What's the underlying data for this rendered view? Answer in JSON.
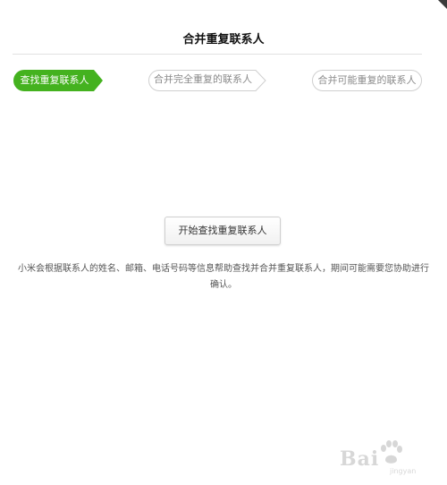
{
  "dialog": {
    "title": "合并重复联系人"
  },
  "steps": [
    {
      "label": "查找重复联系人",
      "state": "active"
    },
    {
      "label": "合并完全重复的联系人",
      "state": "inactive"
    },
    {
      "label": "合并可能重复的联系人",
      "state": "inactive"
    }
  ],
  "main": {
    "start_button_label": "开始查找重复联系人",
    "description": "小米会根据联系人的姓名、邮箱、电话号码等信息帮助查找并合并重复联系人，期间可能需要您协助进行确认。"
  },
  "watermark": {
    "logo_text": "Bai",
    "logo_text_end": "",
    "sub_text": "jingyan"
  },
  "colors": {
    "accent": "#44b21f",
    "inactive_border": "#cfcfcf",
    "inactive_text": "#8a8a8a"
  },
  "icons": {
    "watermark_logo": "baidu-paw-icon"
  }
}
